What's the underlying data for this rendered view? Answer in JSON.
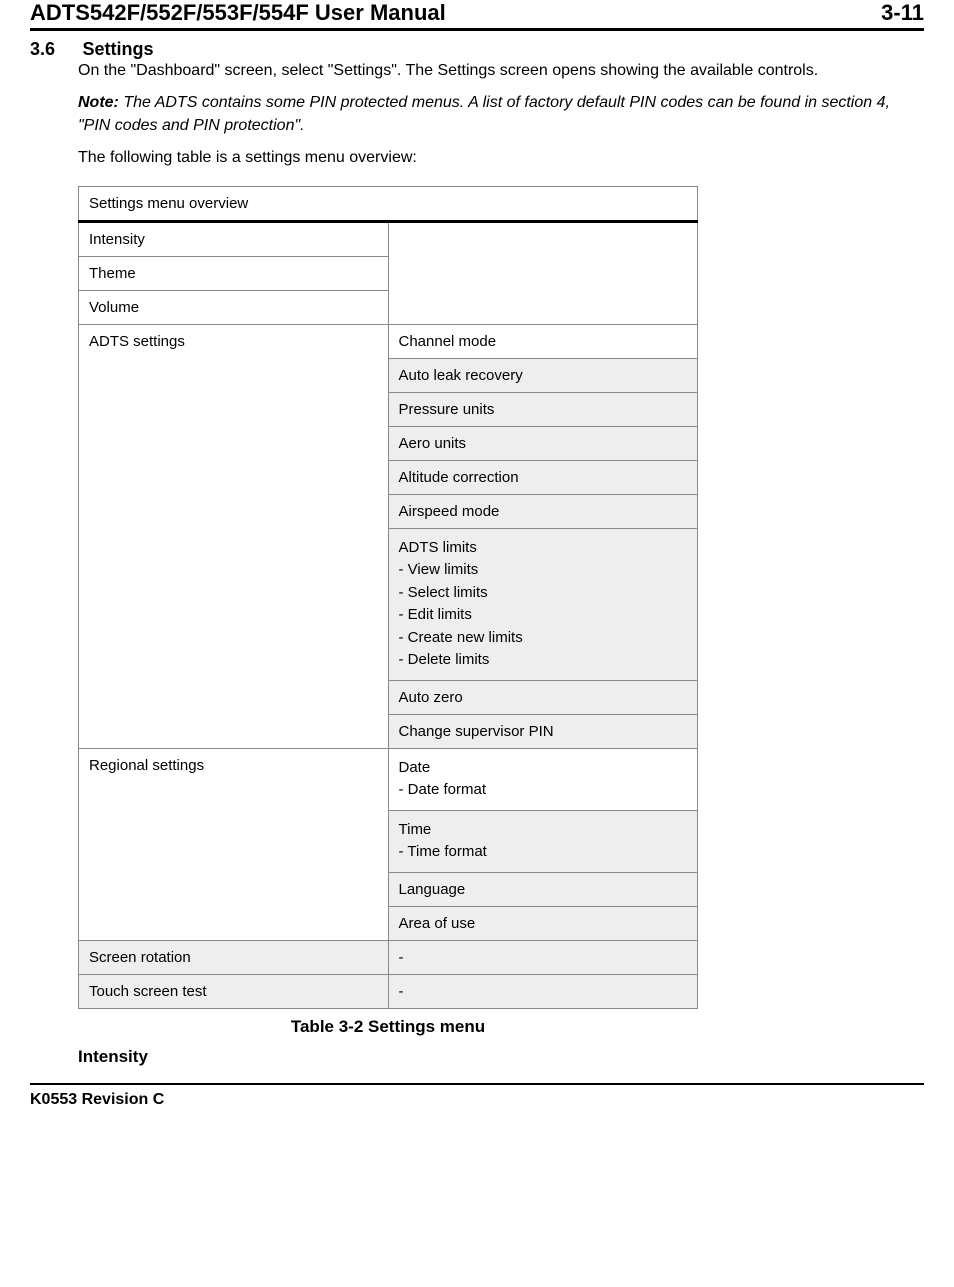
{
  "header": {
    "title": "ADTS542F/552F/553F/554F User Manual",
    "page": "3-11"
  },
  "section": {
    "number": "3.6",
    "title": "Settings",
    "para1": "On the \"Dashboard\" screen, select \"Settings\". The Settings screen opens showing the available controls.",
    "note_label": "Note:",
    "note_text": " The ADTS contains some PIN protected menus. A list of factory default PIN codes can be found in section 4, \"PIN codes and PIN protection\".",
    "para2": "The following table is a settings menu overview:"
  },
  "table": {
    "caption_cell": "Settings menu overview",
    "rows": {
      "intensity": "Intensity",
      "theme": "Theme",
      "volume": "Volume",
      "adts_settings": "ADTS settings",
      "channel_mode": "Channel mode",
      "auto_leak": "Auto leak recovery",
      "pressure_units": "Pressure units",
      "aero_units": "Aero units",
      "altitude": "Altitude correction",
      "airspeed_mode": "Airspeed mode",
      "adts_limits_title": "ADTS limits",
      "adts_limits_1": "- View limits",
      "adts_limits_2": "- Select limits",
      "adts_limits_3": "- Edit limits",
      "adts_limits_4": "- Create new limits",
      "adts_limits_5": "- Delete limits",
      "auto_zero": "Auto zero",
      "change_pin": "Change supervisor PIN",
      "regional": "Regional settings",
      "date_title": "Date",
      "date_format": "- Date format",
      "time_title": "Time",
      "time_format": "- Time format",
      "language": "Language",
      "area_of_use": "Area of use",
      "screen_rotation": "Screen rotation",
      "touch_test": "Touch screen test",
      "dash": "-"
    },
    "bottom_caption": "Table 3-2 Settings menu"
  },
  "subheading": "Intensity",
  "footer": "K0553 Revision C"
}
